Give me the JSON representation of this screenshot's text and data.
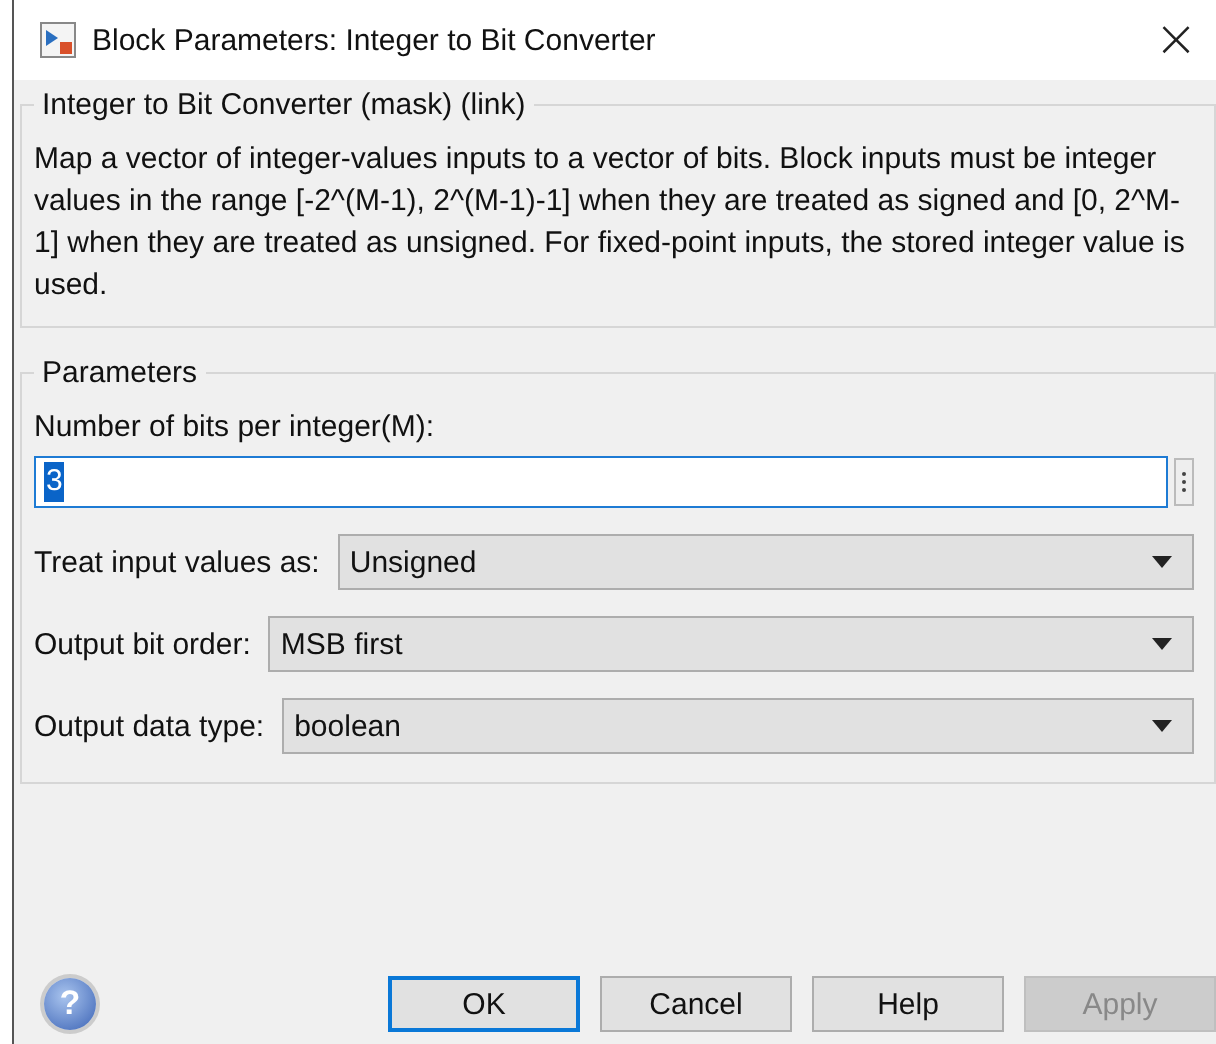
{
  "window": {
    "title": "Block Parameters: Integer to Bit Converter",
    "close": "×"
  },
  "description": {
    "title": "Integer to Bit Converter (mask) (link)",
    "text": "Map a vector of integer-values inputs to a vector of bits.  Block inputs must be integer values in the range [-2^(M-1), 2^(M-1)-1]  when they are treated as signed and [0, 2^M-1] when they are treated as unsigned. For fixed-point inputs, the stored integer value is used."
  },
  "parameters": {
    "title": "Parameters",
    "fields": [
      {
        "kind": "edit",
        "label": "Number of bits per integer(M):",
        "value": "3",
        "selected": true
      },
      {
        "kind": "dropdown",
        "label": "Treat input values as:",
        "value": "Unsigned"
      },
      {
        "kind": "dropdown",
        "label": "Output bit order:",
        "value": "MSB first"
      },
      {
        "kind": "dropdown",
        "label": "Output data type:",
        "value": "boolean"
      }
    ]
  },
  "help_icon": "?",
  "buttons": [
    {
      "label": "OK",
      "default": true,
      "disabled": false
    },
    {
      "label": "Cancel",
      "default": false,
      "disabled": false
    },
    {
      "label": "Help",
      "default": false,
      "disabled": false
    },
    {
      "label": "Apply",
      "default": false,
      "disabled": true
    }
  ]
}
